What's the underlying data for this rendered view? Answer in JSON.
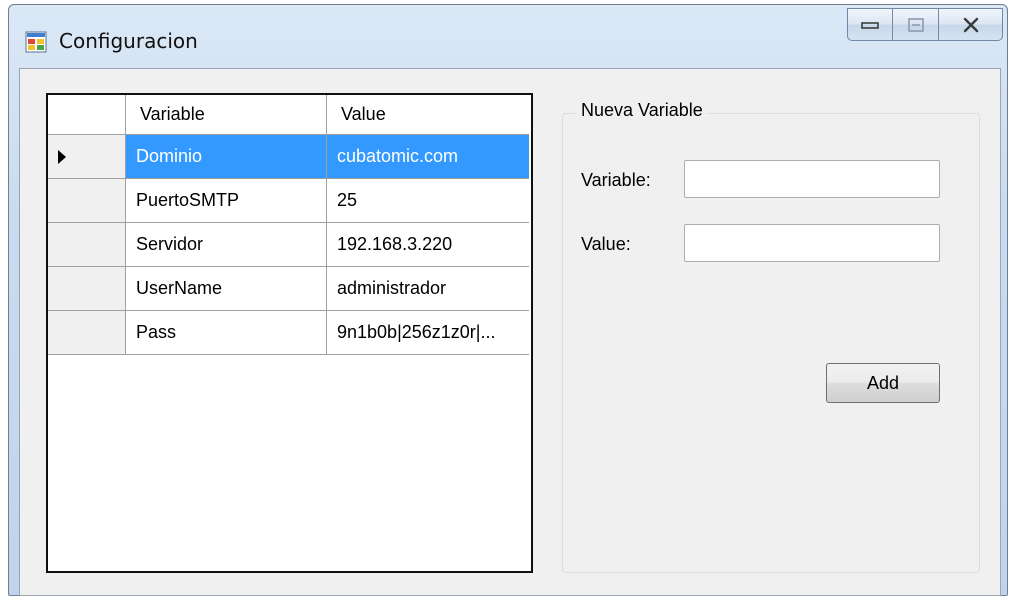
{
  "window": {
    "title": "Configuracion",
    "icon": "form-icon",
    "controls": [
      "minimize-icon",
      "maximize-icon",
      "close-icon"
    ]
  },
  "grid": {
    "columns": [
      "Variable",
      "Value"
    ],
    "rows": [
      {
        "variable": "Dominio",
        "value": "cubatomic.com",
        "selected": true
      },
      {
        "variable": "PuertoSMTP",
        "value": "25",
        "selected": false
      },
      {
        "variable": "Servidor",
        "value": "192.168.3.220",
        "selected": false
      },
      {
        "variable": "UserName",
        "value": "administrador",
        "selected": false
      },
      {
        "variable": "Pass",
        "value": "9n1b0b|256z1z0r|...",
        "selected": false
      }
    ]
  },
  "new_variable": {
    "group_title": "Nueva Variable",
    "variable_label": "Variable:",
    "variable_value": "",
    "value_label": "Value:",
    "value_value": "",
    "add_label": "Add"
  },
  "colors": {
    "selection": "#3399ff",
    "client_bg": "#f0f0f0",
    "title_bar": "#c9dbef"
  }
}
